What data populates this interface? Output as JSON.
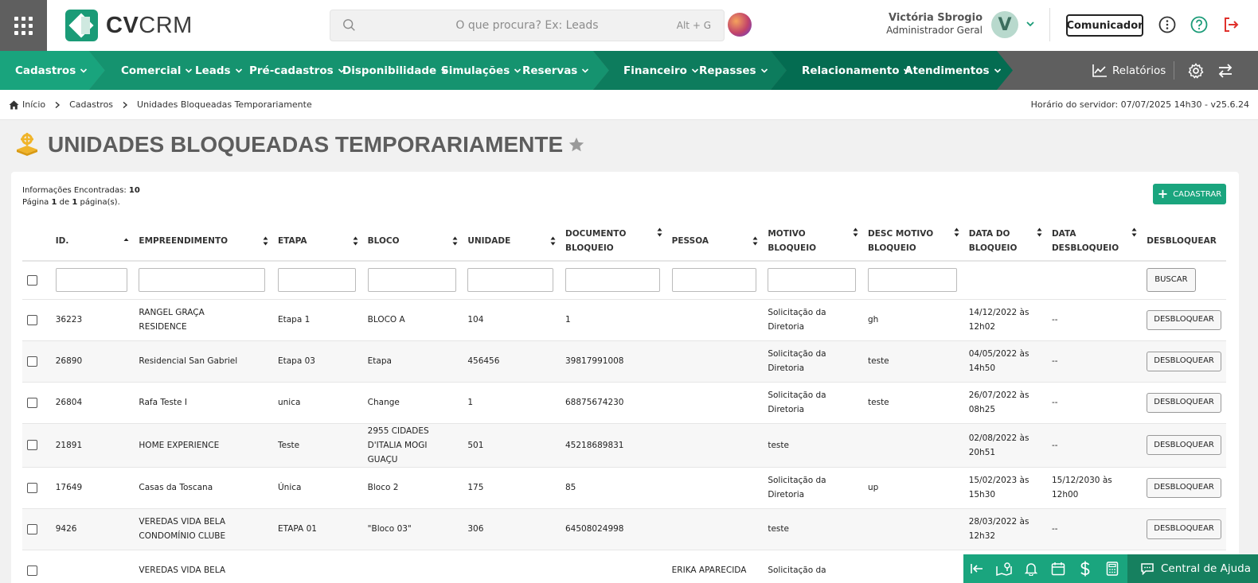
{
  "app": {
    "logo_text_bold": "CV",
    "logo_text": "CRM"
  },
  "search": {
    "placeholder": "O que procura? Ex: Leads",
    "shortcut": "Alt + G"
  },
  "user": {
    "name": "Victória Sbrogio",
    "role": "Administrador Geral",
    "initial": "V"
  },
  "header": {
    "comunicador_label": "Comunicador"
  },
  "nav": {
    "cadastros": "Cadastros",
    "comercial": "Comercial",
    "leads": "Leads",
    "pre_cadastros": "Pré-cadastros",
    "disponibilidade": "Disponibilidade",
    "simulacoes": "Simulações",
    "reservas": "Reservas",
    "financeiro": "Financeiro",
    "repasses": "Repasses",
    "relacionamento": "Relacionamento",
    "atendimentos": "Atendimentos",
    "relatorios": "Relatórios"
  },
  "breadcrumb": {
    "home": "Início",
    "level1": "Cadastros",
    "current": "Unidades Bloqueadas Temporariamente"
  },
  "server_time": "Horário do servidor: 07/07/2025 14h30 - v25.6.24",
  "page": {
    "title": "UNIDADES BLOQUEADAS TEMPORARIAMENTE"
  },
  "info": {
    "found_label": "Informações Encontradas:",
    "found_count": "10",
    "page_prefix": "Página",
    "page_current": "1",
    "page_of": "de",
    "page_total": "1",
    "page_suffix": "página(s)."
  },
  "actions": {
    "cadastrar": "CADASTRAR",
    "buscar": "BUSCAR",
    "desbloquear": "DESBLOQUEAR"
  },
  "table": {
    "headers": {
      "id": "ID.",
      "empreendimento": "EMPREENDIMENTO",
      "etapa": "ETAPA",
      "bloco": "BLOCO",
      "unidade": "UNIDADE",
      "documento_1": "DOCUMENTO",
      "documento_2": "BLOQUEIO",
      "pessoa": "PESSOA",
      "motivo_1": "MOTIVO",
      "motivo_2": "BLOQUEIO",
      "desc_1": "DESC MOTIVO",
      "desc_2": "BLOQUEIO",
      "data_bloq_1": "DATA DO",
      "data_bloq_2": "BLOQUEIO",
      "data_desbloq_1": "DATA",
      "data_desbloq_2": "DESBLOQUEIO",
      "desbloquear": "DESBLOQUEAR"
    },
    "rows": [
      {
        "id": "36223",
        "empreendimento": "RANGEL GRAÇA RESIDENCE",
        "etapa": "Etapa 1",
        "bloco": "BLOCO A",
        "unidade": "104",
        "documento": "1",
        "pessoa": "",
        "motivo": "Solicitação da Diretoria",
        "desc": "gh",
        "data_bloqueio": "14/12/2022 às 12h02",
        "data_desbloqueio": "--"
      },
      {
        "id": "26890",
        "empreendimento": "Residencial San Gabriel",
        "etapa": "Etapa 03",
        "bloco": "Etapa",
        "unidade": "456456",
        "documento": "39817991008",
        "pessoa": "",
        "motivo": "Solicitação da Diretoria",
        "desc": "teste",
        "data_bloqueio": "04/05/2022 às 14h50",
        "data_desbloqueio": "--"
      },
      {
        "id": "26804",
        "empreendimento": "Rafa Teste I",
        "etapa": "unica",
        "bloco": "Change",
        "unidade": "1",
        "documento": "68875674230",
        "pessoa": "",
        "motivo": "Solicitação da Diretoria",
        "desc": "teste",
        "data_bloqueio": "26/07/2022 às 08h25",
        "data_desbloqueio": "--"
      },
      {
        "id": "21891",
        "empreendimento": "HOME EXPERIENCE",
        "etapa": "Teste",
        "bloco": "2955 CIDADES D'ITALIA MOGI GUAÇU",
        "unidade": "501",
        "documento": "45218689831",
        "pessoa": "",
        "motivo": "teste",
        "desc": "",
        "data_bloqueio": "02/08/2022 às 20h51",
        "data_desbloqueio": "--"
      },
      {
        "id": "17649",
        "empreendimento": "Casas da Toscana",
        "etapa": "Única",
        "bloco": "Bloco 2",
        "unidade": "175",
        "documento": "85",
        "pessoa": "",
        "motivo": "Solicitação da Diretoria",
        "desc": "up",
        "data_bloqueio": "15/02/2023 às 15h30",
        "data_desbloqueio": "15/12/2030 às 12h00"
      },
      {
        "id": "9426",
        "empreendimento": "VEREDAS VIDA BELA CONDOMÍNIO CLUBE",
        "etapa": "ETAPA 01",
        "bloco": "\"Bloco 03\"",
        "unidade": "306",
        "documento": "64508024998",
        "pessoa": "",
        "motivo": "teste",
        "desc": "",
        "data_bloqueio": "28/03/2022 às 12h32",
        "data_desbloqueio": "--"
      },
      {
        "id": "",
        "empreendimento": "VEREDAS VIDA BELA",
        "etapa": "",
        "bloco": "",
        "unidade": "",
        "documento": "",
        "pessoa": "ERIKA APARECIDA",
        "motivo": "Solicitação da",
        "desc": "",
        "data_bloqueio": "",
        "data_desbloqueio": ""
      }
    ]
  },
  "dock": {
    "help_label": "Central de Ajuda"
  },
  "colors": {
    "brand_green": "#1aa57e",
    "dark_green": "#16805f",
    "nav_gray": "#5f5f5f",
    "logout_red": "#e0312c"
  }
}
